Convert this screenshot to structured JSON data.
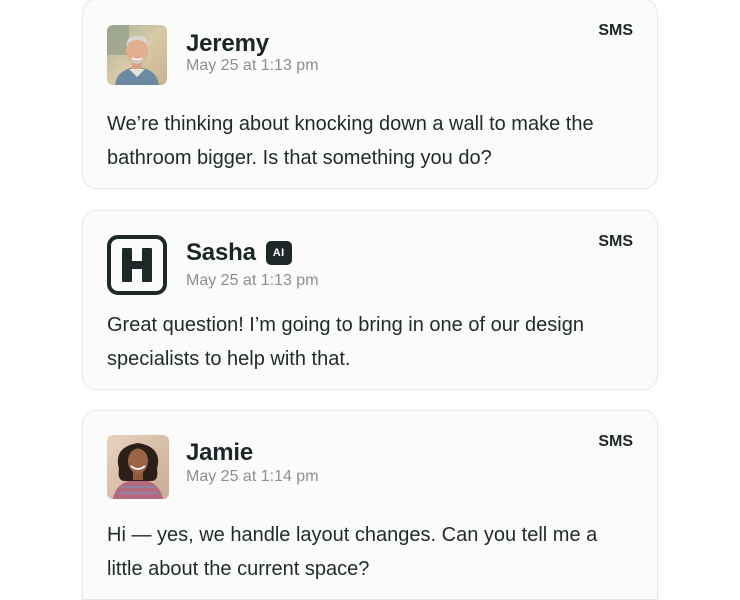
{
  "messages": [
    {
      "author": "Jeremy",
      "timestamp": "May 25 at 1:13 pm",
      "channel": "SMS",
      "text": "We’re thinking about knocking down a wall to make the bathroom bigger. Is that something you do?",
      "avatar_icon": "person-photo-icon"
    },
    {
      "author": "Sasha",
      "badge": "AI",
      "timestamp": "May 25 at 1:13 pm",
      "channel": "SMS",
      "text": "Great question! I’m going to bring in one of our design specialists to help with that.",
      "avatar_icon": "brand-logo-icon",
      "avatar_letter": "H"
    },
    {
      "author": "Jamie",
      "timestamp": "May 25 at 1:14 pm",
      "channel": "SMS",
      "text": "Hi — yes, we handle layout changes. Can you tell me a little about the current space?",
      "avatar_icon": "person-photo-icon"
    }
  ],
  "colors": {
    "text_primary": "#1c2626",
    "text_muted": "#8a8f93",
    "card_background": "#fbfbfc",
    "card_border": "#e6e7ea",
    "badge_background": "#1e2828"
  }
}
